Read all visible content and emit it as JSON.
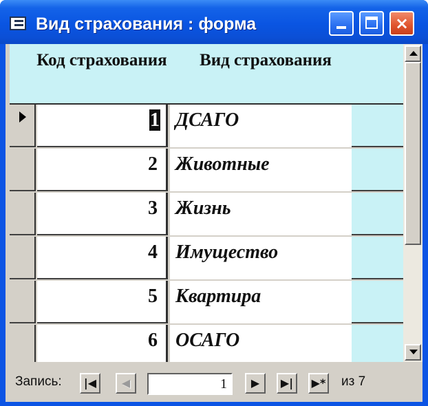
{
  "window": {
    "title": "Вид страхования : форма",
    "icon": "form-icon",
    "controls": {
      "minimize": "minimize-icon",
      "maximize": "maximize-icon",
      "close": "×"
    }
  },
  "table": {
    "columns": {
      "code": "Код страхования",
      "name": "Вид страхования"
    },
    "rows": [
      {
        "code": "1",
        "name": "ДСАГО"
      },
      {
        "code": "2",
        "name": "Животные"
      },
      {
        "code": "3",
        "name": "Жизнь"
      },
      {
        "code": "4",
        "name": "Имущество"
      },
      {
        "code": "5",
        "name": "Квартира"
      },
      {
        "code": "6",
        "name": "ОСАГО"
      }
    ],
    "current_row": 0,
    "colors": {
      "header_bg": "#c9f2f6",
      "cell_bg": "#ffffff"
    }
  },
  "navigator": {
    "label": "Запись:",
    "first": "|◀",
    "prev": "◀",
    "current_record": "1",
    "next": "▶",
    "last": "▶|",
    "new": "▶*",
    "total": "из 7"
  }
}
